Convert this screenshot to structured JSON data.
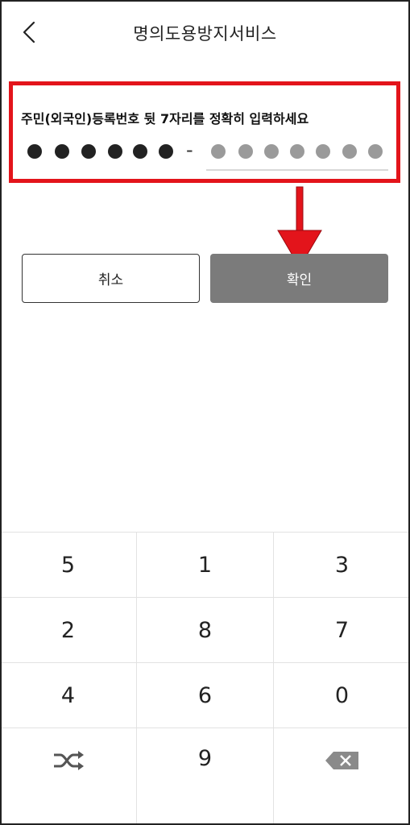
{
  "header": {
    "title": "명의도용방지서비스",
    "back_icon": "chevron-left-icon"
  },
  "form": {
    "instruction": "주민(외국인)등록번호 뒷 7자리를 정확히 입력하세요",
    "entered_digits": 6,
    "total_digits": 7,
    "front_digits": 6,
    "separator": "-"
  },
  "buttons": {
    "cancel_label": "취소",
    "confirm_label": "확인"
  },
  "keypad": {
    "rows": [
      [
        "5",
        "1",
        "3"
      ],
      [
        "2",
        "8",
        "7"
      ],
      [
        "4",
        "6",
        "0"
      ],
      [
        "shuffle-icon",
        "9",
        "backspace-icon"
      ]
    ]
  },
  "colors": {
    "highlight": "#e3141b",
    "confirm_button": "#7b7b7b",
    "filled_dot": "#222222",
    "empty_dot": "#9a9a9a"
  }
}
